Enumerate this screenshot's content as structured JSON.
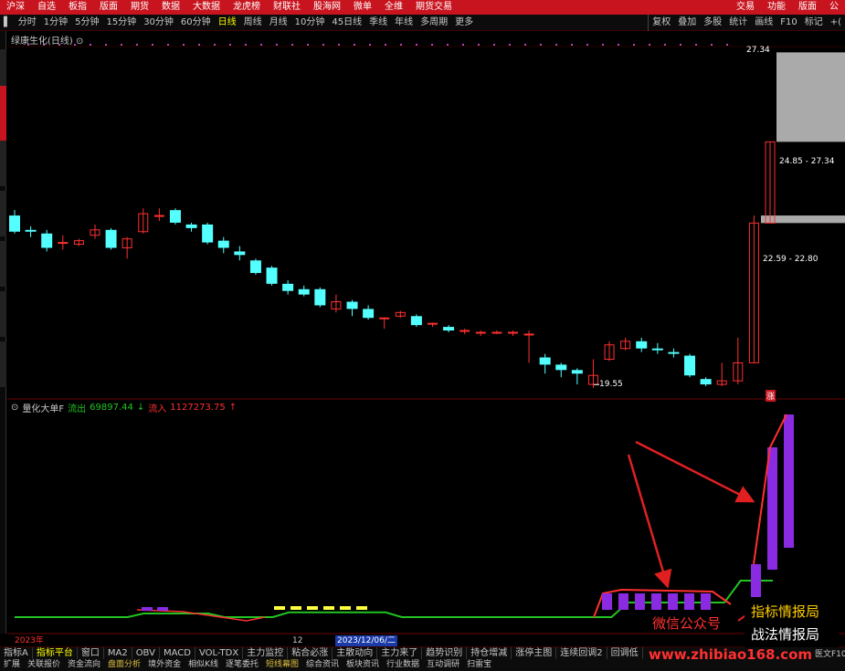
{
  "menu": {
    "items": [
      "沪深",
      "自选",
      "板指",
      "版面",
      "期货",
      "数据",
      "大数据",
      "龙虎榜",
      "财联社",
      "股海网",
      "微单",
      "全维",
      "期货交易"
    ],
    "right": [
      "交易",
      "功能",
      "版面",
      "公"
    ]
  },
  "periods": {
    "items": [
      "分时",
      "1分钟",
      "5分钟",
      "15分钟",
      "30分钟",
      "60分钟",
      "日线",
      "周线",
      "月线",
      "10分钟",
      "45日线",
      "季线",
      "年线",
      "多周期",
      "更多"
    ],
    "active": "日线",
    "right": [
      "复权",
      "叠加",
      "多股",
      "统计",
      "画线",
      "F10",
      "标记",
      "+("
    ]
  },
  "stock": {
    "title": "绿康生化(日线)"
  },
  "price_labels": {
    "high_tag": "27.34",
    "zone_upper": "24.85 - 27.34",
    "zone_lower": "22.59 - 22.80",
    "low_tag": "19.55",
    "corner_badge": "涨"
  },
  "indicator": {
    "name": "量化大单F",
    "flow_label": "流出",
    "flow_value": "69897.44",
    "flow_arrow": "↓",
    "buy_label": "流入",
    "buy_value": "1127273.75",
    "buy_arrow": "↑"
  },
  "dates": {
    "year": "2023年",
    "mid": "12",
    "selected": "2023/12/06/二"
  },
  "tabs1": {
    "items": [
      "指标A",
      "指标平台",
      "窗口",
      "MA2",
      "OBV",
      "MACD",
      "VOL-TDX",
      "主力监控",
      "粘合必涨",
      "主散动向",
      "主力来了",
      "趋势识别",
      "持仓增减",
      "涨停主图",
      "连续回调2",
      "回调低"
    ],
    "active": "指标平台"
  },
  "tabs2": {
    "items": [
      "扩展",
      "关联报价",
      "资金流向",
      "盘面分析",
      "境外资金",
      "相似K线",
      "逐笔委托",
      "短线幕图",
      "综合资讯",
      "板块资讯",
      "行业数据",
      "互动调研",
      "扫雷宝"
    ],
    "highlight": [
      "盘面分析",
      "短线幕图"
    ]
  },
  "watermark": {
    "line1": "指标情报局",
    "line2": "战法情报局",
    "line3": "微信公众号",
    "url": "www.zhibiao168.com",
    "edge": "医文F10"
  },
  "colors": {
    "menubar": "#c8141e",
    "bull": "#ff3030",
    "bear": "#54ffff",
    "purple_bar": "#8a2be2",
    "flow_line_green": "#22c322",
    "flow_line_red": "#ff3030",
    "active_tab": "#ffff00"
  },
  "chart_data": {
    "type": "candlestick",
    "series_up": [
      {
        "o": 21.6,
        "c": 21.7,
        "h": 21.9,
        "l": 21.4
      },
      {
        "o": 21.65,
        "c": 21.8,
        "h": 21.95,
        "l": 21.5
      },
      {
        "o": 21.7,
        "c": 22.2,
        "h": 22.3,
        "l": 21.0
      }
    ],
    "candles": [
      {
        "o": 22.8,
        "c": 22.35,
        "h": 22.95,
        "l": 22.3
      },
      {
        "o": 22.4,
        "c": 22.35,
        "h": 22.5,
        "l": 22.2
      },
      {
        "o": 22.3,
        "c": 21.9,
        "h": 22.4,
        "l": 21.8
      },
      {
        "o": 22.05,
        "c": 22.05,
        "h": 22.25,
        "l": 21.85
      },
      {
        "o": 22.0,
        "c": 22.1,
        "h": 22.15,
        "l": 21.95
      },
      {
        "o": 22.25,
        "c": 22.4,
        "h": 22.55,
        "l": 22.15
      },
      {
        "o": 22.4,
        "c": 21.9,
        "h": 22.45,
        "l": 21.85
      },
      {
        "o": 21.9,
        "c": 22.15,
        "h": 22.2,
        "l": 21.6
      },
      {
        "o": 22.35,
        "c": 22.85,
        "h": 23.0,
        "l": 22.3
      },
      {
        "o": 22.8,
        "c": 22.8,
        "h": 23.0,
        "l": 22.65
      },
      {
        "o": 22.95,
        "c": 22.6,
        "h": 23.0,
        "l": 22.55
      },
      {
        "o": 22.55,
        "c": 22.45,
        "h": 22.6,
        "l": 22.35
      },
      {
        "o": 22.55,
        "c": 22.05,
        "h": 22.6,
        "l": 22.0
      },
      {
        "o": 22.1,
        "c": 21.9,
        "h": 22.2,
        "l": 21.75
      },
      {
        "o": 21.8,
        "c": 21.7,
        "h": 21.95,
        "l": 21.55
      },
      {
        "o": 21.55,
        "c": 21.2,
        "h": 21.6,
        "l": 21.15
      },
      {
        "o": 21.35,
        "c": 20.9,
        "h": 21.4,
        "l": 20.85
      },
      {
        "o": 20.9,
        "c": 20.7,
        "h": 21.0,
        "l": 20.6
      },
      {
        "o": 20.75,
        "c": 20.6,
        "h": 20.85,
        "l": 20.55
      },
      {
        "o": 20.75,
        "c": 20.3,
        "h": 20.8,
        "l": 20.25
      },
      {
        "o": 20.2,
        "c": 20.4,
        "h": 20.6,
        "l": 20.1
      },
      {
        "o": 20.4,
        "c": 20.2,
        "h": 20.45,
        "l": 20.0
      },
      {
        "o": 20.2,
        "c": 19.95,
        "h": 20.3,
        "l": 19.9
      },
      {
        "o": 19.95,
        "c": 19.95,
        "h": 19.97,
        "l": 19.65
      },
      {
        "o": 20.0,
        "c": 20.1,
        "h": 20.15,
        "l": 19.95
      },
      {
        "o": 20.0,
        "c": 19.75,
        "h": 20.05,
        "l": 19.7
      },
      {
        "o": 19.8,
        "c": 19.8,
        "h": 19.82,
        "l": 19.7
      },
      {
        "o": 19.7,
        "c": 19.6,
        "h": 19.75,
        "l": 19.55
      },
      {
        "o": 19.6,
        "c": 19.6,
        "h": 19.65,
        "l": 19.5
      },
      {
        "o": 19.55,
        "c": 19.55,
        "h": 19.6,
        "l": 19.45
      },
      {
        "o": 19.55,
        "c": 19.55,
        "h": 19.6,
        "l": 19.5
      },
      {
        "o": 19.55,
        "c": 19.55,
        "h": 19.6,
        "l": 19.45
      },
      {
        "o": 19.5,
        "c": 19.5,
        "h": 19.6,
        "l": 18.7
      },
      {
        "o": 18.85,
        "c": 18.65,
        "h": 18.95,
        "l": 18.4
      },
      {
        "o": 18.65,
        "c": 18.5,
        "h": 18.7,
        "l": 18.3
      },
      {
        "o": 18.5,
        "c": 18.4,
        "h": 18.55,
        "l": 18.1
      },
      {
        "o": 18.1,
        "c": 18.35,
        "h": 18.8,
        "l": 18.0
      },
      {
        "o": 18.8,
        "c": 19.2,
        "h": 19.3,
        "l": 18.75
      },
      {
        "o": 19.1,
        "c": 19.3,
        "h": 19.4,
        "l": 19.05
      },
      {
        "o": 19.3,
        "c": 19.1,
        "h": 19.4,
        "l": 19.0
      },
      {
        "o": 19.1,
        "c": 19.05,
        "h": 19.25,
        "l": 18.95
      },
      {
        "o": 19.0,
        "c": 18.95,
        "h": 19.1,
        "l": 18.85
      },
      {
        "o": 18.9,
        "c": 18.35,
        "h": 18.95,
        "l": 18.3
      },
      {
        "o": 18.25,
        "c": 18.1,
        "h": 18.3,
        "l": 18.05
      },
      {
        "o": 18.1,
        "c": 18.2,
        "h": 18.7,
        "l": 18.05
      },
      {
        "o": 18.2,
        "c": 18.7,
        "h": 19.4,
        "l": 18.1
      },
      {
        "o": 18.7,
        "c": 22.59,
        "h": 22.8,
        "l": 18.7
      },
      {
        "o": 22.59,
        "c": 24.85,
        "h": 24.85,
        "l": 22.59
      }
    ],
    "indicator_bars": [
      {
        "x": 0,
        "low": 0.1,
        "high": 0.18
      },
      {
        "x": 1,
        "low": 0.1,
        "high": 0.2
      },
      {
        "x": 2,
        "low": 0.09,
        "high": 0.18
      },
      {
        "x": 3,
        "low": 0.09,
        "high": 0.19
      },
      {
        "x": 4,
        "low": 0.09,
        "high": 0.18
      },
      {
        "x": 5,
        "low": 0.09,
        "high": 0.18
      },
      {
        "x": 6,
        "low": 0.1,
        "high": 0.18
      },
      {
        "x": 8,
        "low": 0.14,
        "high": 0.3
      },
      {
        "x": 9,
        "low": 0.4,
        "high": 0.82
      },
      {
        "x": 10,
        "low": 0.45,
        "high": 1.0
      }
    ]
  }
}
